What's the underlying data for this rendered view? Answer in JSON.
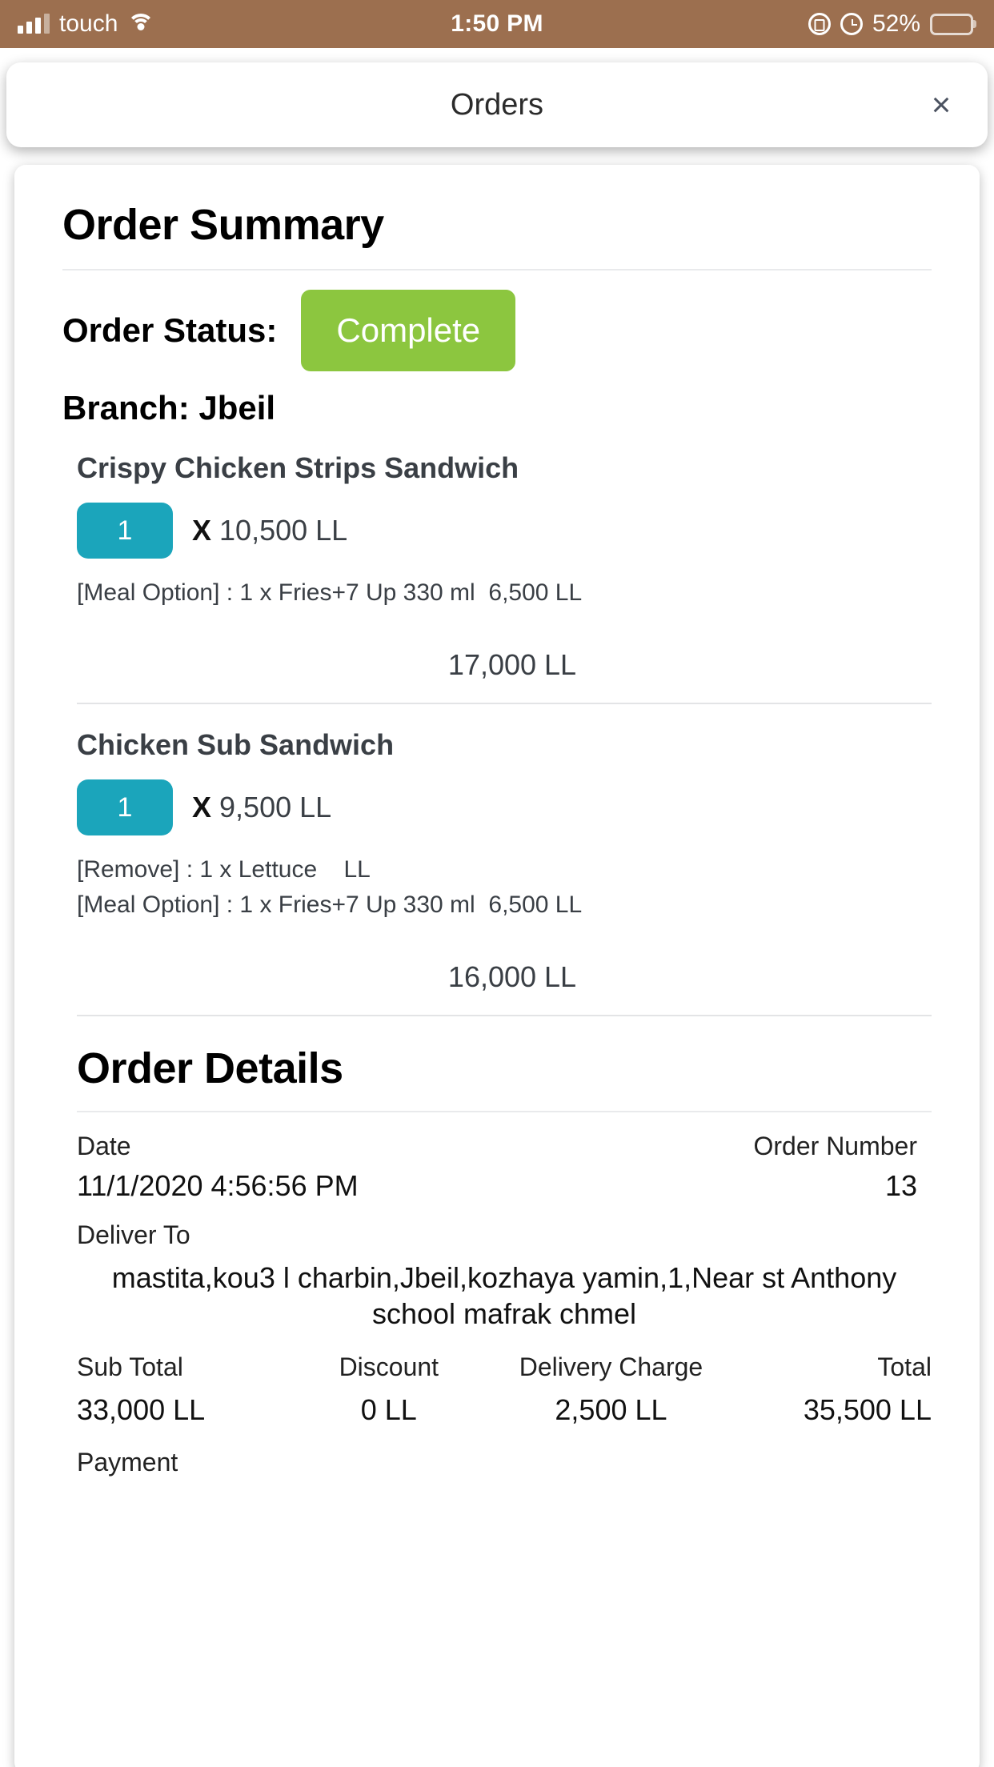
{
  "status_bar": {
    "carrier": "touch",
    "time": "1:50 PM",
    "battery_percent": "52%",
    "icons": {
      "signal": "signal-bars-icon",
      "wifi": "wifi-icon",
      "rotation_lock": "rotation-lock-icon",
      "alarm": "alarm-clock-icon",
      "battery": "battery-icon"
    },
    "background_color": "#9c6f4f"
  },
  "header": {
    "title": "Orders",
    "close_label": "×"
  },
  "order_summary": {
    "title": "Order Summary",
    "status_label": "Order Status:",
    "status_value": "Complete",
    "status_color": "#8cc63f",
    "branch": "Branch: Jbeil",
    "qty_badge_color": "#1ba5bb",
    "items": [
      {
        "name": "Crispy Chicken Strips Sandwich",
        "qty": "1",
        "multiplier": "X",
        "unit_price": "10,500 LL",
        "options": [
          "[Meal Option] : 1 x Fries+7 Up 330 ml  6,500 LL"
        ],
        "line_total": "17,000 LL"
      },
      {
        "name": "Chicken Sub Sandwich",
        "qty": "1",
        "multiplier": "X",
        "unit_price": "9,500 LL",
        "options": [
          "[Remove] : 1 x Lettuce    LL",
          "[Meal Option] : 1 x Fries+7 Up 330 ml  6,500 LL"
        ],
        "line_total": "16,000 LL"
      }
    ]
  },
  "order_details": {
    "title": "Order Details",
    "date_label": "Date",
    "date_value": "11/1/2020 4:56:56 PM",
    "order_number_label": "Order Number",
    "order_number_value": "13",
    "deliver_to_label": "Deliver To",
    "deliver_to_value": "mastita,kou3 l charbin,Jbeil,kozhaya yamin,1,Near st Anthony school mafrak chmel",
    "totals": {
      "sub_total_label": "Sub Total",
      "sub_total_value": "33,000 LL",
      "discount_label": "Discount",
      "discount_value": "0 LL",
      "delivery_charge_label": "Delivery Charge",
      "delivery_charge_value": "2,500 LL",
      "total_label": "Total",
      "total_value": "35,500 LL"
    },
    "payment_label": "Payment"
  }
}
